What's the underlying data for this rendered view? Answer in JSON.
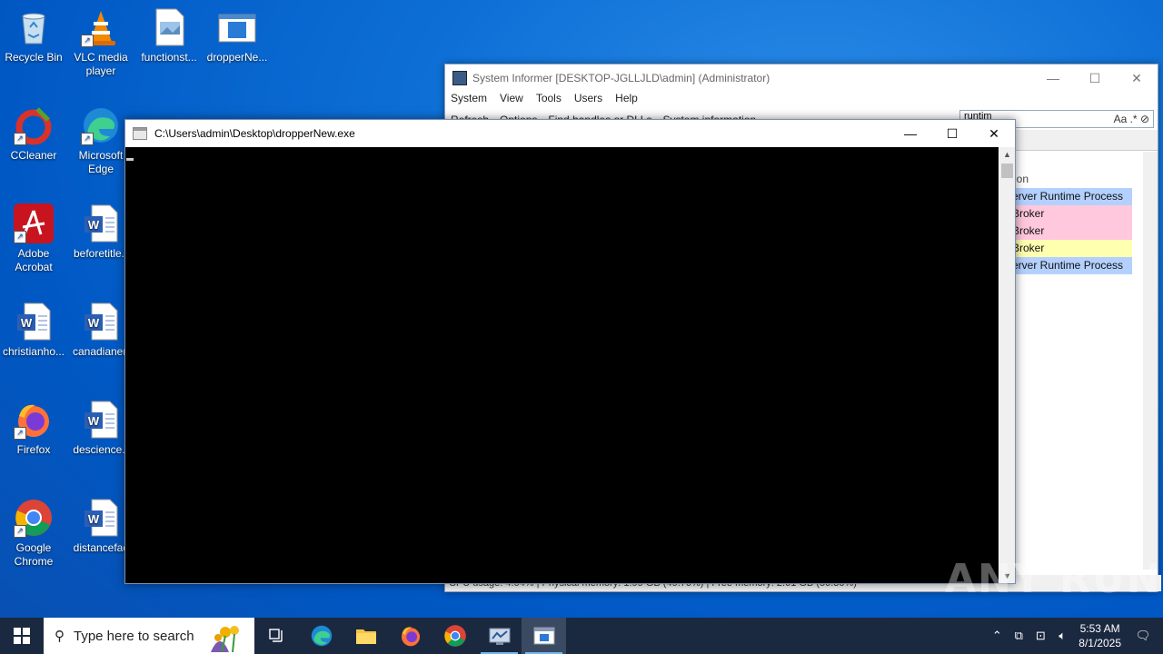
{
  "desktop_icons": [
    {
      "label": "Recycle Bin"
    },
    {
      "label": "VLC media player"
    },
    {
      "label": "functionst..."
    },
    {
      "label": "dropperNe..."
    },
    {
      "label": "CCleaner"
    },
    {
      "label": "Microsoft Edge"
    },
    {
      "label": "Adobe Acrobat"
    },
    {
      "label": "beforetitle.r"
    },
    {
      "label": "christianho..."
    },
    {
      "label": "canadianen"
    },
    {
      "label": "Firefox"
    },
    {
      "label": "descience.r"
    },
    {
      "label": "Google Chrome"
    },
    {
      "label": "distancefac"
    }
  ],
  "system_informer": {
    "title": "System Informer [DESKTOP-JGLLJLD\\admin] (Administrator)",
    "menu": [
      "System",
      "View",
      "Tools",
      "Users",
      "Help"
    ],
    "toolbar": [
      "Refresh",
      "Options",
      "Find handles or DLLs",
      "System information"
    ],
    "search_value": "runtim",
    "search_icons": "Aa .* ",
    "column_header": "ion",
    "rows": [
      {
        "text": "erver Runtime Process",
        "color": "#b4d0ff"
      },
      {
        "text": "Broker",
        "color": "#ffc8dc"
      },
      {
        "text": "Broker",
        "color": "#ffc8dc"
      },
      {
        "text": "Broker",
        "color": "#ffffb0"
      },
      {
        "text": "erver Runtime Process",
        "color": "#b4d0ff"
      }
    ],
    "status": "CPU usage: 4.04%   |   Physical memory: 1.99 GB (49.70%)   |   Free memory: 2.01 GB (50.30%)"
  },
  "console": {
    "title": "C:\\Users\\admin\\Desktop\\dropperNew.exe"
  },
  "watermark": "ANY RUN",
  "taskbar": {
    "search_placeholder": "Type here to search",
    "time": "5:53 AM",
    "date": "8/1/2025"
  }
}
